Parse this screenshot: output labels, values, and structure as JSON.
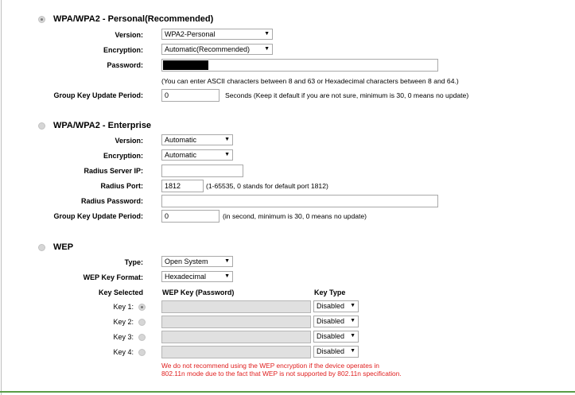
{
  "wpa_personal": {
    "title": "WPA/WPA2 - Personal(Recommended)",
    "version_label": "Version:",
    "version_value": "WPA2-Personal",
    "encryption_label": "Encryption:",
    "encryption_value": "Automatic(Recommended)",
    "password_label": "Password:",
    "password_hint": "(You can enter ASCII characters between 8 and 63 or Hexadecimal characters between 8 and 64.)",
    "gkup_label": "Group Key Update Period:",
    "gkup_value": "0",
    "gkup_hint": "Seconds (Keep it default if you are not sure, minimum is 30, 0 means no update)"
  },
  "wpa_enterprise": {
    "title": "WPA/WPA2 - Enterprise",
    "version_label": "Version:",
    "version_value": "Automatic",
    "encryption_label": "Encryption:",
    "encryption_value": "Automatic",
    "radius_ip_label": "Radius Server IP:",
    "radius_ip_value": "",
    "radius_port_label": "Radius Port:",
    "radius_port_value": "1812",
    "radius_port_hint": "(1-65535, 0 stands for default port 1812)",
    "radius_password_label": "Radius Password:",
    "radius_password_value": "",
    "gkup_label": "Group Key Update Period:",
    "gkup_value": "0",
    "gkup_hint": "(in second, minimum is 30, 0 means no update)"
  },
  "wep": {
    "title": "WEP",
    "type_label": "Type:",
    "type_value": "Open System",
    "format_label": "WEP Key Format:",
    "format_value": "Hexadecimal",
    "col_key_selected": "Key Selected",
    "col_wep_key": "WEP Key (Password)",
    "col_key_type": "Key Type",
    "keys": [
      {
        "label": "Key 1:",
        "type": "Disabled"
      },
      {
        "label": "Key 2:",
        "type": "Disabled"
      },
      {
        "label": "Key 3:",
        "type": "Disabled"
      },
      {
        "label": "Key 4:",
        "type": "Disabled"
      }
    ],
    "warning_line1": "We do not recommend using the WEP encryption if the device operates in",
    "warning_line2": "802.11n mode due to the fact that WEP is not supported by 802.11n specification."
  },
  "colors": {
    "warning": "#e02020",
    "divider": "#5a9c46"
  }
}
